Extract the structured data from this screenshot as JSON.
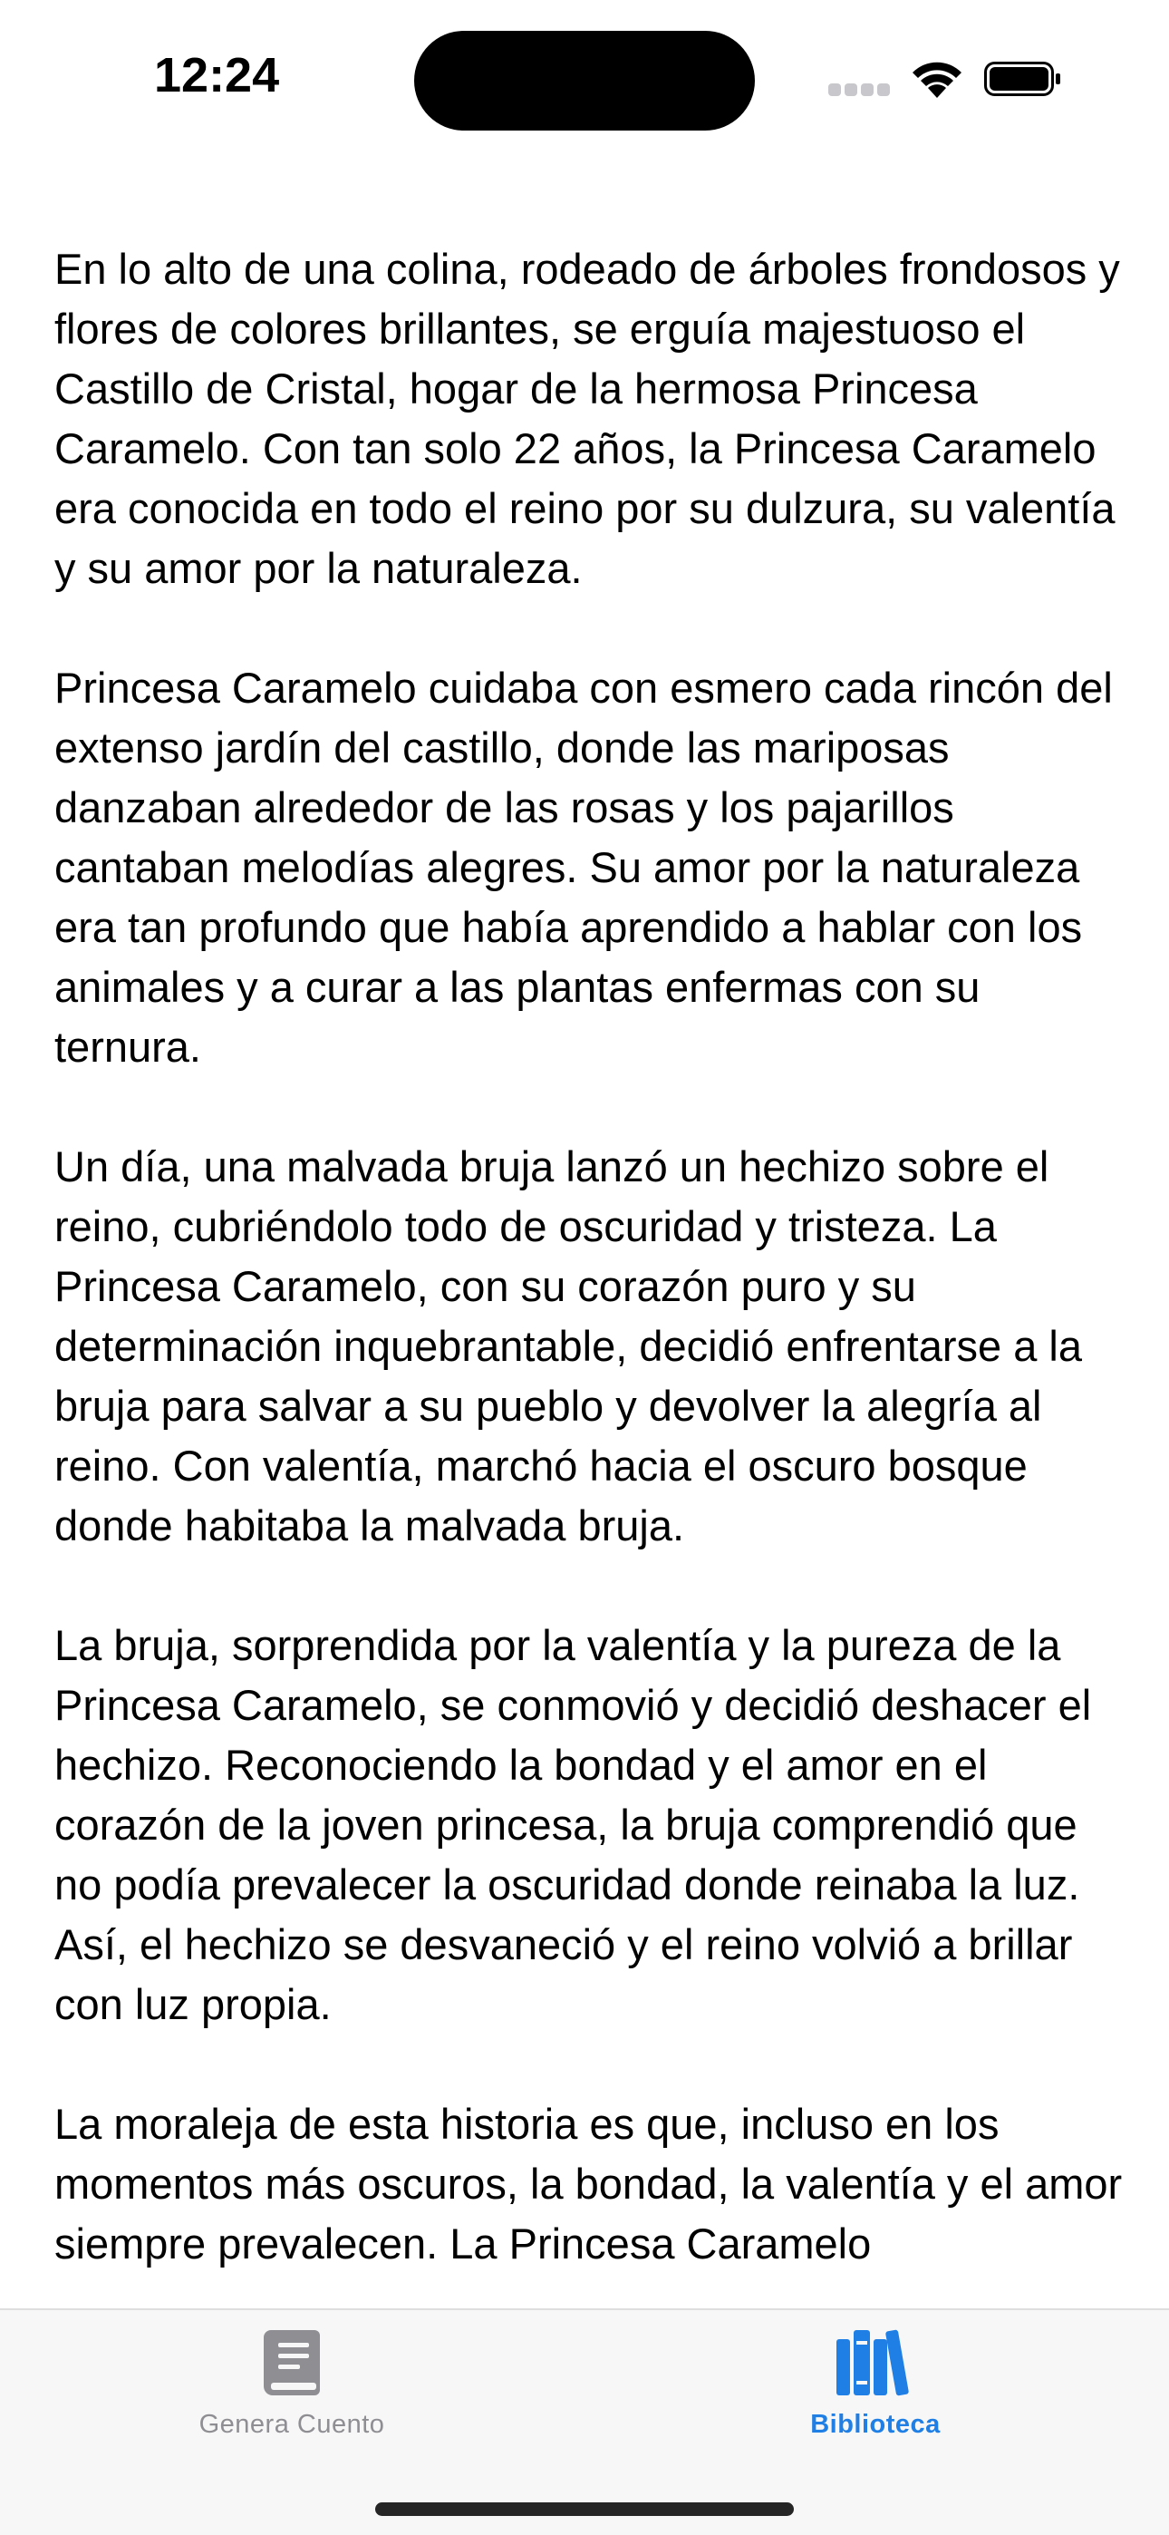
{
  "status_bar": {
    "time": "12:24"
  },
  "story": {
    "paragraphs": [
      "En lo alto de una colina, rodeado de árboles frondosos y flores de colores brillantes, se erguía majestuoso el Castillo de Cristal, hogar de la hermosa Princesa Caramelo. Con tan solo 22 años, la Princesa Caramelo era conocida en todo el reino por su dulzura, su valentía y su amor por la naturaleza.",
      "Princesa Caramelo cuidaba con esmero cada rincón del extenso jardín del castillo, donde las mariposas danzaban alrededor de las rosas y los pajarillos cantaban melodías alegres. Su amor por la naturaleza era tan profundo que había aprendido a hablar con los animales y a curar a las plantas enfermas con su ternura.",
      "Un día, una malvada bruja lanzó un hechizo sobre el reino, cubriéndolo todo de oscuridad y tristeza. La Princesa Caramelo, con su corazón puro y su determinación inquebrantable, decidió enfrentarse a la bruja para salvar a su pueblo y devolver la alegría al reino. Con valentía, marchó hacia el oscuro bosque donde habitaba la malvada bruja.",
      "La bruja, sorprendida por la valentía y la pureza de la Princesa Caramelo, se conmovió y decidió deshacer el hechizo. Reconociendo la bondad y el amor en el corazón de la joven princesa, la bruja comprendió que no podía prevalecer la oscuridad donde reinaba la luz. Así, el hechizo se desvaneció y el reino volvió a brillar con luz propia.",
      "La moraleja de esta historia es que, incluso en los momentos más oscuros, la bondad, la valentía y el amor siempre prevalecen. La Princesa Caramelo"
    ]
  },
  "tab_bar": {
    "tabs": [
      {
        "label": "Genera Cuento",
        "icon": "book-icon",
        "selected": false
      },
      {
        "label": "Biblioteca",
        "icon": "books-library-icon",
        "selected": true
      }
    ]
  },
  "colors": {
    "accent": "#1f7fe5",
    "inactive_tab": "#8e8e93",
    "tab_bar_bg": "#f7f7f7"
  }
}
